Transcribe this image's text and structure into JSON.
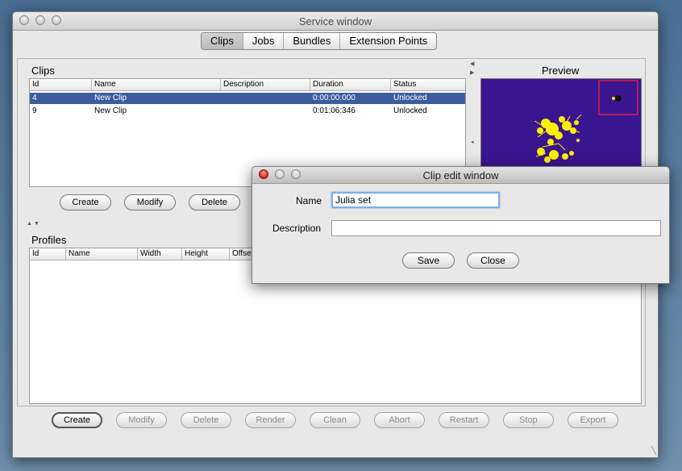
{
  "service_window": {
    "title": "Service window",
    "tabs": [
      {
        "label": "Clips",
        "selected": true
      },
      {
        "label": "Jobs",
        "selected": false
      },
      {
        "label": "Bundles",
        "selected": false
      },
      {
        "label": "Extension Points",
        "selected": false
      }
    ],
    "clips": {
      "label": "Clips",
      "columns": [
        "Id",
        "Name",
        "Description",
        "Duration",
        "Status"
      ],
      "rows": [
        {
          "id": "4",
          "name": "New Clip",
          "description": "",
          "duration": "0:00:00:000",
          "status": "Unlocked",
          "selected": true
        },
        {
          "id": "9",
          "name": "New Clip",
          "description": "",
          "duration": "0:01:06:346",
          "status": "Unlocked",
          "selected": false
        }
      ],
      "buttons": {
        "create": "Create",
        "modify": "Modify",
        "delete": "Delete"
      }
    },
    "preview": {
      "label": "Preview"
    },
    "profiles": {
      "label": "Profiles",
      "columns": [
        "Id",
        "Name",
        "Width",
        "Height",
        "Offse"
      ],
      "buttons": {
        "create": "Create",
        "modify": "Modify",
        "delete": "Delete",
        "render": "Render",
        "clean": "Clean",
        "abort": "Abort",
        "restart": "Restart",
        "stop": "Stop",
        "export": "Export"
      }
    }
  },
  "clip_edit": {
    "title": "Clip edit window",
    "name_label": "Name",
    "name_value": "Julia set",
    "description_label": "Description",
    "description_value": "",
    "save": "Save",
    "close": "Close"
  },
  "colors": {
    "selection": "#3d5c9d",
    "preview_bg": "#3a1590",
    "fractal": "#ffee00",
    "close_button": "#d8261a"
  }
}
